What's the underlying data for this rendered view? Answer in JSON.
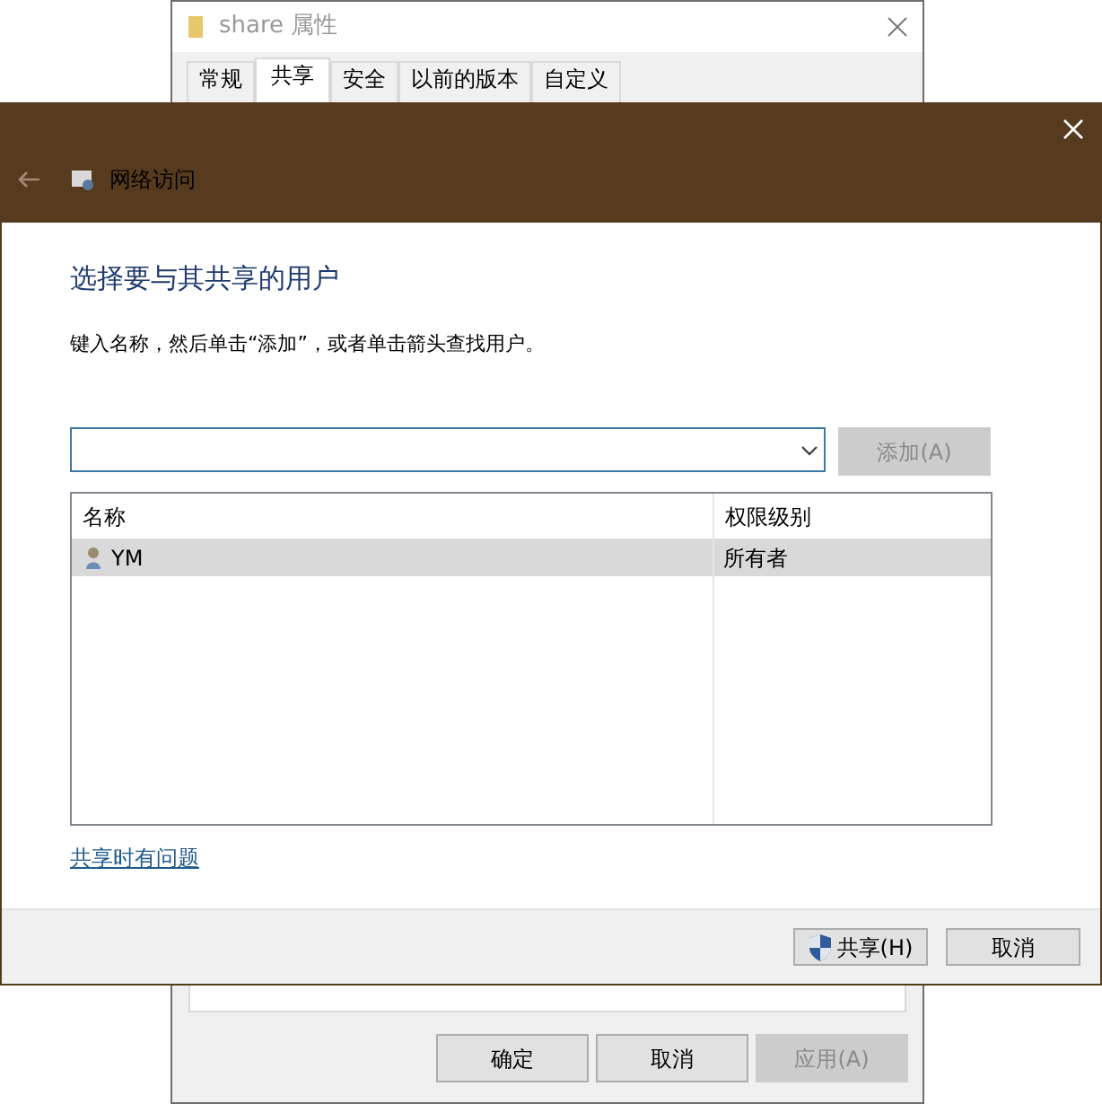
{
  "background_window": {
    "title": "share 属性",
    "tabs": [
      {
        "label": "常规",
        "selected": false
      },
      {
        "label": "共享",
        "selected": true
      },
      {
        "label": "安全",
        "selected": false
      },
      {
        "label": "以前的版本",
        "selected": false
      },
      {
        "label": "自定义",
        "selected": false
      }
    ],
    "buttons": [
      {
        "label": "确定",
        "disabled": false
      },
      {
        "label": "取消",
        "disabled": false
      },
      {
        "label": "应用(A)",
        "disabled": true
      }
    ]
  },
  "dialog": {
    "breadcrumb": "网络访问",
    "heading": "选择要与其共享的用户",
    "instruction": "键入名称，然后单击“添加”，或者单击箭头查找用户。",
    "add_button": {
      "label": "添加(A)",
      "disabled": true
    },
    "table": {
      "columns": [
        "名称",
        "权限级别"
      ],
      "rows": [
        {
          "name": "YM",
          "permission": "所有者",
          "selected": true
        }
      ]
    },
    "link": "共享时有问题",
    "buttons": [
      {
        "label": "共享(H)",
        "kind": "shield"
      },
      {
        "label": "取消",
        "kind": "plain"
      }
    ]
  }
}
